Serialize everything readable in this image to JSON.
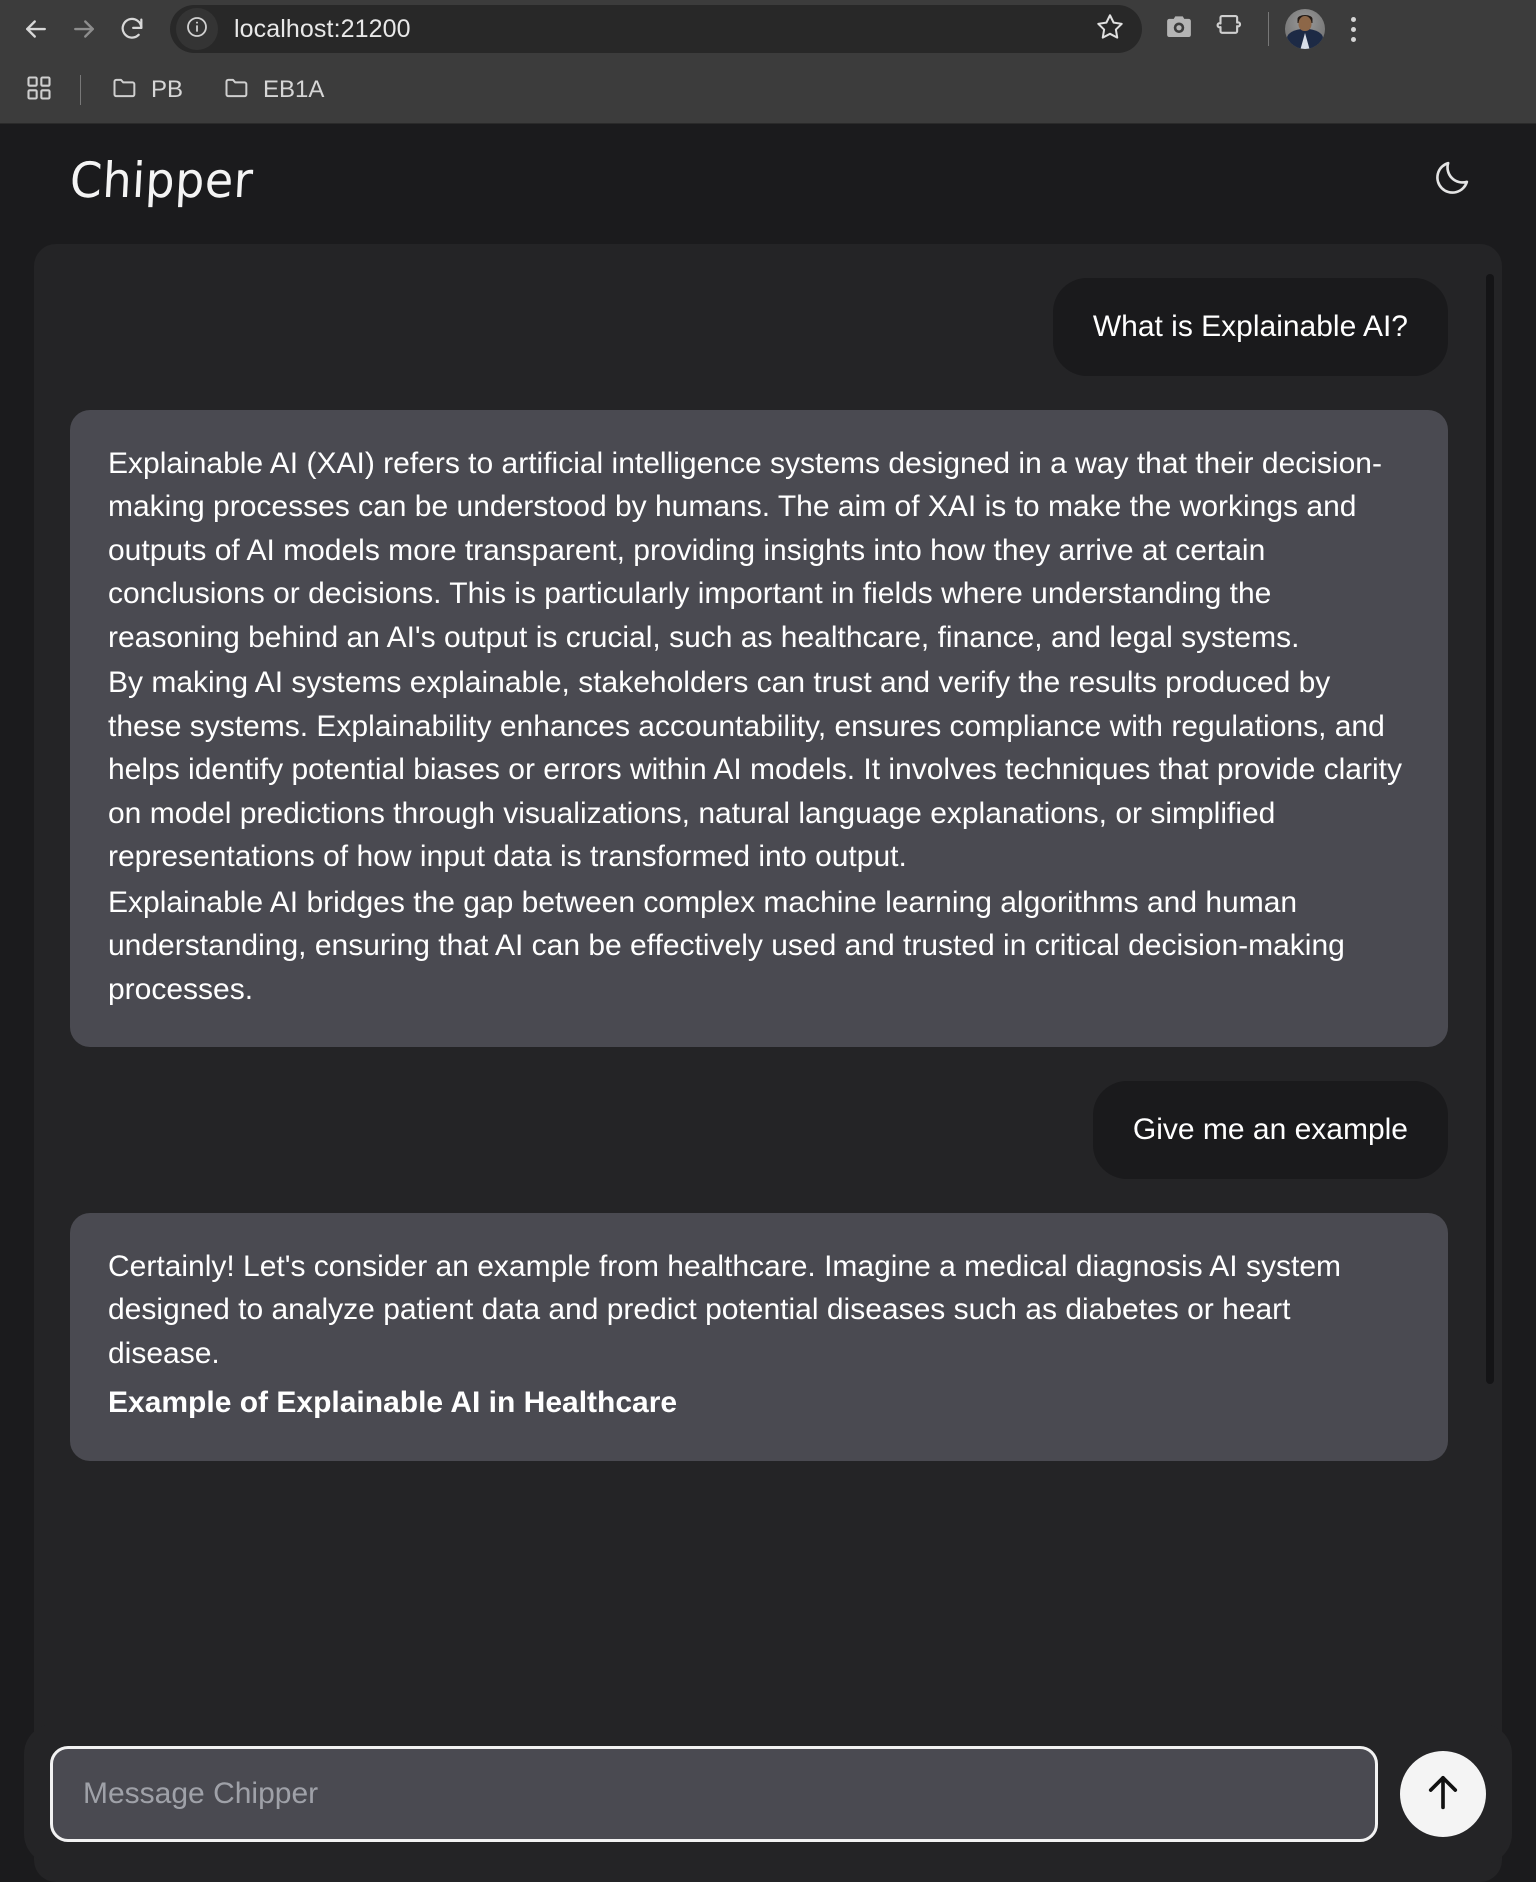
{
  "browser": {
    "back_icon": "arrow-left-icon",
    "forward_icon": "arrow-right-icon",
    "reload_icon": "reload-icon",
    "site_info_icon": "info-circle-icon",
    "url": "localhost:21200",
    "bookmark_star_icon": "star-icon",
    "screenshot_icon": "camera-icon",
    "extensions_icon": "puzzle-piece-icon",
    "profile_icon": "avatar",
    "menu_icon": "three-dots-vertical-icon",
    "bookmarks": {
      "apps_icon": "apps-grid-icon",
      "items": [
        {
          "icon": "folder-icon",
          "label": "PB"
        },
        {
          "icon": "folder-icon",
          "label": "EB1A"
        }
      ]
    }
  },
  "app": {
    "title": "Chipper",
    "theme_toggle_icon": "moon-icon",
    "accent_send_color": "#f4f4f4",
    "assistant_bubble_color": "#4a4a51",
    "user_bubble_color": "#1a1a1c",
    "panel_color": "#242426",
    "background_color": "#1b1b1d"
  },
  "conversation": {
    "messages": [
      {
        "role": "user",
        "text": "What is Explainable AI?"
      },
      {
        "role": "assistant",
        "paragraphs": [
          "Explainable AI (XAI) refers to artificial intelligence systems designed in a way that their decision-making processes can be understood by humans. The aim of XAI is to make the workings and outputs of AI models more transparent, providing insights into how they arrive at certain conclusions or decisions. This is particularly important in fields where understanding the reasoning behind an AI's output is crucial, such as healthcare, finance, and legal systems.",
          "By making AI systems explainable, stakeholders can trust and verify the results produced by these systems. Explainability enhances accountability, ensures compliance with regulations, and helps identify potential biases or errors within AI models. It involves techniques that provide clarity on model predictions through visualizations, natural language explanations, or simplified representations of how input data is transformed into output.",
          "Explainable AI bridges the gap between complex machine learning algorithms and human understanding, ensuring that AI can be effectively used and trusted in critical decision-making processes."
        ]
      },
      {
        "role": "user",
        "text": "Give me an example"
      },
      {
        "role": "assistant",
        "paragraphs": [
          "Certainly! Let's consider an example from healthcare. Imagine a medical diagnosis AI system designed to analyze patient data and predict potential diseases such as diabetes or heart disease."
        ],
        "clipped_heading": "Example of Explainable AI in Healthcare"
      }
    ]
  },
  "composer": {
    "placeholder": "Message Chipper",
    "value": "",
    "send_icon": "arrow-up-icon"
  }
}
